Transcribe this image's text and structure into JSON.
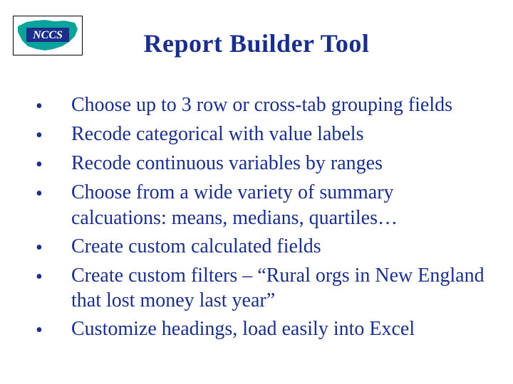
{
  "logo": {
    "label": "NCCS"
  },
  "title": "Report Builder Tool",
  "bullets": [
    "Choose up to 3 row or cross-tab grouping fields",
    "Recode categorical with value labels",
    "Recode continuous variables by ranges",
    "Choose from a wide variety of summary calcuations: means, medians, quartiles…",
    "Create custom calculated fields",
    "Create custom filters – “Rural orgs in New England that lost money last year”",
    "Customize headings, load easily into Excel"
  ]
}
